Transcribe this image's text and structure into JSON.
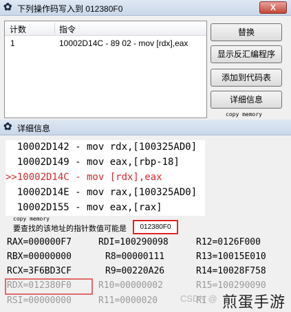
{
  "top_window": {
    "title": "下列操作码写入到 012380F0",
    "close_label": "X",
    "list": {
      "columns": [
        "计数",
        "指令"
      ],
      "rows": [
        {
          "count": "1",
          "instruction": "10002D14C - 89 02  - mov [rdx],eax"
        }
      ]
    },
    "buttons": [
      "替换",
      "显示反汇编程序",
      "添加到代码表",
      "详细信息"
    ],
    "button_note": "copy memory"
  },
  "details_window": {
    "title": "详细信息",
    "code_lines": [
      "  10002D142 - mov rdx,[100325AD0]",
      "  10002D149 - mov eax,[rbp-18]",
      ">>10002D14C - mov [rdx],eax",
      "  10002D14E - mov rax,[100325AD0]",
      "  10002D155 - mov eax,[rax]"
    ],
    "copy_memory": "copy memory",
    "hint": "要查找的该地址的指针数值可能是",
    "hint_value": "012380F0",
    "registers": [
      [
        "RAX=000000F7",
        "RDI=100290098",
        "R12=0126F000"
      ],
      [
        "RBX=00000000",
        "R8=00000111",
        "R13=10015E010"
      ],
      [
        "RCX=3F6BD3CF",
        "R9=00220A26",
        "R14=10028F758"
      ],
      [
        "RDX=012380F0",
        "R10=00000002",
        "R15=100290090"
      ],
      [
        "RSI=00000000",
        "R11=0000020",
        "RI"
      ]
    ]
  },
  "watermark": {
    "site": "CSDN @",
    "brand": "煎蛋手游"
  },
  "colors": {
    "highlight_red": "#d6262b",
    "box_red": "#e02424"
  }
}
